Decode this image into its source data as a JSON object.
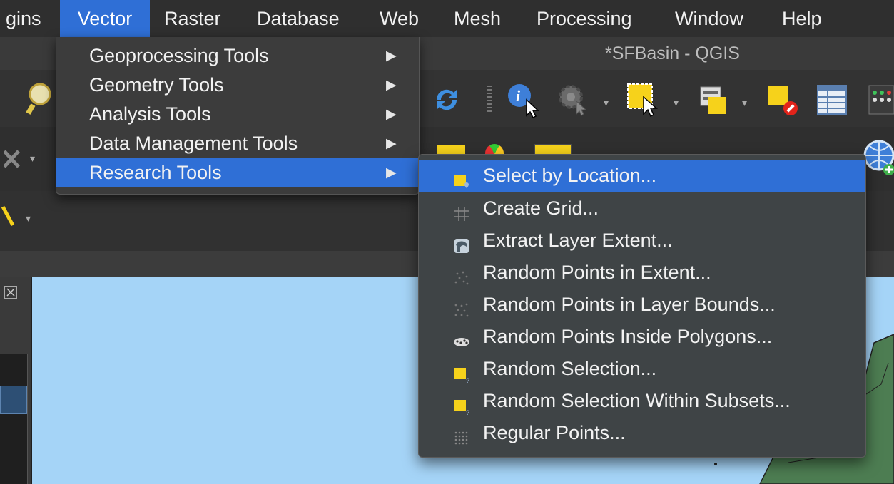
{
  "app": {
    "window_title": "*SFBasin - QGIS"
  },
  "menubar": {
    "items": [
      {
        "label": "gins",
        "active": false
      },
      {
        "label": "Vector",
        "active": true
      },
      {
        "label": "Raster",
        "active": false
      },
      {
        "label": "Database",
        "active": false
      },
      {
        "label": "Web",
        "active": false
      },
      {
        "label": "Mesh",
        "active": false
      },
      {
        "label": "Processing",
        "active": false
      },
      {
        "label": "Window",
        "active": false
      },
      {
        "label": "Help",
        "active": false
      }
    ]
  },
  "vector_menu": {
    "items": [
      {
        "label": "Geoprocessing Tools",
        "has_submenu": true
      },
      {
        "label": "Geometry Tools",
        "has_submenu": true
      },
      {
        "label": "Analysis Tools",
        "has_submenu": true
      },
      {
        "label": "Data Management Tools",
        "has_submenu": true
      },
      {
        "label": "Research Tools",
        "has_submenu": true,
        "highlighted": true
      }
    ],
    "arrow_glyph": "▶"
  },
  "research_submenu": {
    "items": [
      {
        "label": "Select by Location...",
        "icon": "select-by-location-icon",
        "highlighted": true
      },
      {
        "label": "Create Grid...",
        "icon": "grid-icon"
      },
      {
        "label": "Extract Layer Extent...",
        "icon": "layer-extent-icon"
      },
      {
        "label": "Random Points in Extent...",
        "icon": "random-points-icon"
      },
      {
        "label": "Random Points in Layer Bounds...",
        "icon": "random-points-bounds-icon"
      },
      {
        "label": "Random Points Inside Polygons...",
        "icon": "random-points-polygons-icon"
      },
      {
        "label": "Random Selection...",
        "icon": "random-selection-icon"
      },
      {
        "label": "Random Selection Within Subsets...",
        "icon": "random-selection-subsets-icon"
      },
      {
        "label": "Regular Points...",
        "icon": "regular-points-icon"
      }
    ]
  },
  "colors": {
    "accent": "#2f6fd6",
    "menu_bg": "#3c3c3c",
    "canvas_water": "#a5d4f7",
    "selection_yellow": "#f6d21b"
  }
}
